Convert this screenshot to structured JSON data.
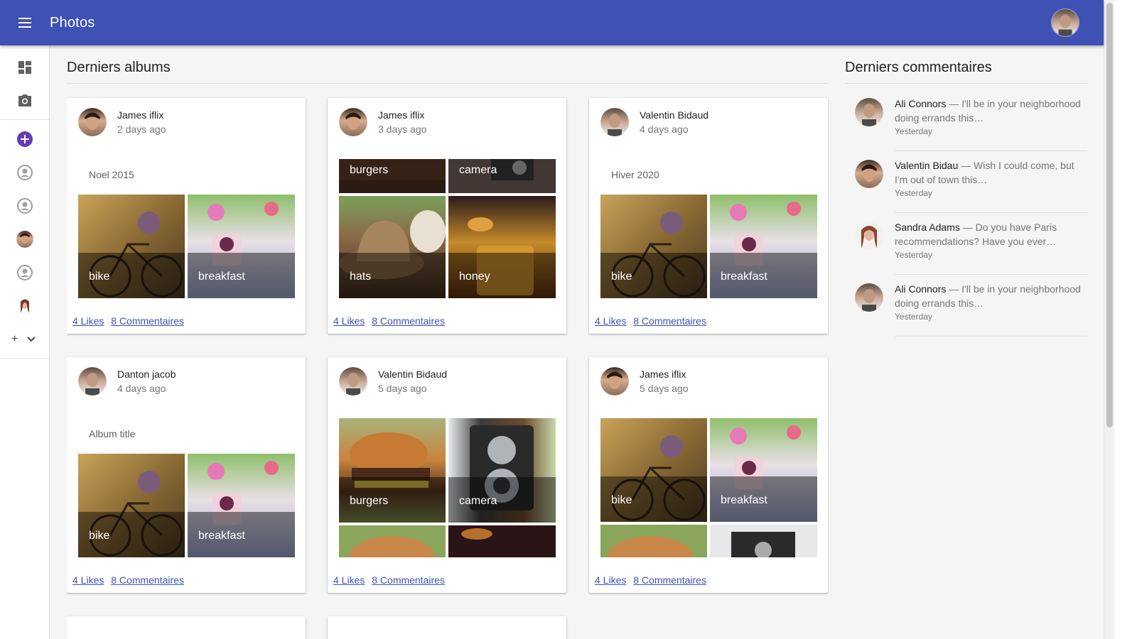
{
  "app": {
    "title": "Photos",
    "menu_icon": "menu-icon"
  },
  "colors": {
    "primary": "#3f51b5",
    "fab": "#673ab7"
  },
  "sidebar": {
    "items": [
      {
        "icon": "dashboard-icon"
      },
      {
        "icon": "camera-icon"
      },
      {
        "icon": "add-circle-icon"
      },
      {
        "icon": "account-circle-icon"
      },
      {
        "icon": "account-circle-icon"
      },
      {
        "icon": "avatar"
      },
      {
        "icon": "account-circle-icon"
      },
      {
        "icon": "avatar"
      }
    ],
    "more_label": "+"
  },
  "albums": {
    "title": "Derniers albums",
    "cards": [
      {
        "author": "James iflix",
        "time": "2 days ago",
        "album": "Noel 2015",
        "tiles": [
          "bike",
          "breakfast"
        ],
        "likes": "4 Likes",
        "comments": "8 Commentaires"
      },
      {
        "author": "James iflix",
        "time": "3 days ago",
        "album": "",
        "tiles": [
          "burgers",
          "camera",
          "hats",
          "honey"
        ],
        "likes": "4 Likes",
        "comments": "8 Commentaires"
      },
      {
        "author": "Valentin Bidaud",
        "time": "4 days ago",
        "album": "Hiver 2020",
        "tiles": [
          "bike",
          "breakfast"
        ],
        "likes": "4 Likes",
        "comments": "8 Commentaires"
      },
      {
        "author": "Danton jacob",
        "time": "4 days ago",
        "album": "Album title",
        "tiles": [
          "bike",
          "breakfast"
        ],
        "likes": "4 Likes",
        "comments": "8 Commentaires"
      },
      {
        "author": "Valentin Bidaud",
        "time": "5 days ago",
        "album": "",
        "tiles": [
          "burgers",
          "camera"
        ],
        "likes": "4 Likes",
        "comments": "8 Commentaires"
      },
      {
        "author": "James iflix",
        "time": "5 days ago",
        "album": "",
        "tiles": [
          "bike",
          "breakfast"
        ],
        "likes": "4 Likes",
        "comments": "8 Commentaires"
      }
    ]
  },
  "comments": {
    "title": "Derniers commentaires",
    "items": [
      {
        "author": "Ali Connors",
        "text": " — I'll be in your neighborhood doing errands this…",
        "time": "Yesterday"
      },
      {
        "author": "Valentin Bidau",
        "text": " — Wish I could come, but I'm out of town this…",
        "time": "Yesterday"
      },
      {
        "author": "Sandra Adams",
        "text": " — Do you have Paris recommendations? Have you ever…",
        "time": "Yesterday"
      },
      {
        "author": "Ali Connors",
        "text": " — I'll be in your neighborhood doing errands this…",
        "time": "Yesterday"
      }
    ]
  }
}
